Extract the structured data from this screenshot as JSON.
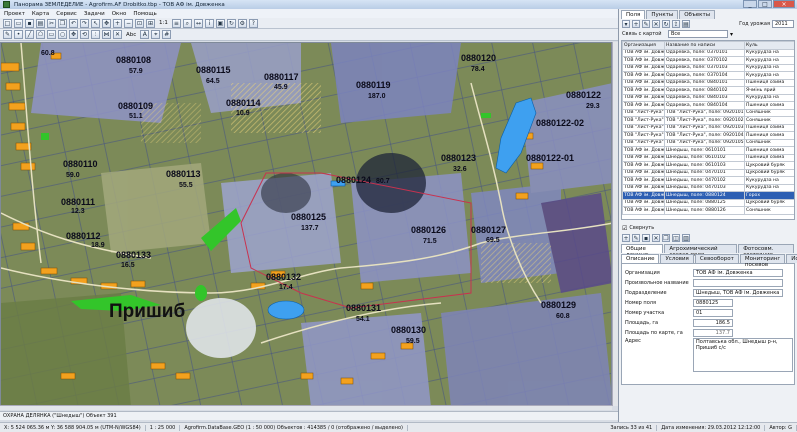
{
  "window": {
    "title": "Панорама ЗЕМЛЕДЕЛИЕ - Agrofirm.AF Drobitko.tbp - ТОВ АФ ім. Довженка",
    "controls": [
      "_",
      "□",
      "×"
    ]
  },
  "menu": [
    "Проект",
    "Карта",
    "Сервис",
    "Задачи",
    "Окно",
    "Помощь"
  ],
  "toolbar": {
    "scale_ratio": "1:1",
    "text_label": "Abc"
  },
  "map": {
    "parcels": [
      {
        "id": "0880108",
        "area": "57.9"
      },
      {
        "id": "0880115",
        "area": "64.5"
      },
      {
        "id": "0880117",
        "area": "45.9"
      },
      {
        "id": "0880119",
        "area": "187.0"
      },
      {
        "id": "0880120",
        "area": "78.4"
      },
      {
        "id": "0880122",
        "area": "29.3"
      },
      {
        "id": "0880109",
        "area": "51.1"
      },
      {
        "id": "0880114",
        "area": "10.9"
      },
      {
        "id": "0880122-02",
        "area": ""
      },
      {
        "id": "0880110",
        "area": "59.0"
      },
      {
        "id": "0880113",
        "area": "55.5"
      },
      {
        "id": "0880123",
        "area": "32.6"
      },
      {
        "id": "0880122-01",
        "area": ""
      },
      {
        "id": "0880111",
        "area": "12.3"
      },
      {
        "id": "0880124",
        "area": "80.7"
      },
      {
        "id": "0880125",
        "area": "137.7"
      },
      {
        "id": "0880126",
        "area": "71.5"
      },
      {
        "id": "0880127",
        "area": "69.5"
      },
      {
        "id": "0880112",
        "area": "18.9"
      },
      {
        "id": "0880133",
        "area": "16.5"
      },
      {
        "id": "0880132",
        "area": "17.4"
      },
      {
        "id": "0880131",
        "area": "54.1"
      },
      {
        "id": "0880129",
        "area": "60.8"
      },
      {
        "id": "0880130",
        "area": "59.5"
      },
      {
        "id": "",
        "area": "60.8"
      }
    ],
    "village_label": "Пришиб"
  },
  "statusbar": {
    "object_line": "ОХРАНА ДЕЛЯНКА (\"Шнедыш\") Объект 391",
    "coords": "X: 5 524 065.36 м   Y: 36 588 904.05 м   (UTM-N/WGS84)",
    "scale": "1 : 25 000",
    "db": "Agrofirm.DataBase.GEO (1 : 50 000)   Объектов : 414385 / 0 (отображено / выделено)",
    "records": "Запись 33 из 41",
    "date": "Дата изменения: 29.03.2012 12:12:00",
    "author": "Автор: G"
  },
  "panel": {
    "tabs": [
      "Поля",
      "Пункты",
      "Объекты"
    ],
    "year_label": "Год урожая",
    "year_value": "2011",
    "link_label": "Связь с картой",
    "link_value": "Все",
    "columns": [
      "Организация",
      "Название по написи",
      "Куль"
    ],
    "rows": [
      [
        "ТОВ АФ ім. Довженка",
        "Одаревка, поле: 0370101",
        "Кукурудза на"
      ],
      [
        "ТОВ АФ ім. Довженка",
        "Одаревка, поле: 0370102",
        "Кукурудза на"
      ],
      [
        "ТОВ АФ ім. Довженка",
        "Одаревка, поле: 0370103",
        "Кукурудза на"
      ],
      [
        "ТОВ АФ ім. Довженка",
        "Одаревка, поле: 0370104",
        "Кукурудза на"
      ],
      [
        "ТОВ АФ ім. Довженка",
        "Одаревка, поле: 0840101",
        "Пшениця озима"
      ],
      [
        "ТОВ АФ ім. Довженка",
        "Одаревка, поле: 0840102",
        "Ячмінь ярий"
      ],
      [
        "ТОВ АФ ім. Довженка",
        "Одаревка, поле: 0840103",
        "Кукурудза на"
      ],
      [
        "ТОВ АФ ім. Довженка",
        "Одаревка, поле: 0840104",
        "Пшениця озима"
      ],
      [
        "ТОВ \"Лист-Рука\"",
        "ТОВ \"Лист-Рука\", поле: 0920101",
        "Соняшник"
      ],
      [
        "ТОВ \"Лист-Рука\"",
        "ТОВ \"Лист-Рука\", поле: 0920102",
        "Соняшник"
      ],
      [
        "ТОВ \"Лист-Рука\"",
        "ТОВ \"Лист-Рука\", поле: 0920103",
        "Пшениця озима"
      ],
      [
        "ТОВ \"Лист-Рука\"",
        "ТОВ \"Лист-Рука\", поле: 0920104",
        "Пшениця озима"
      ],
      [
        "ТОВ \"Лист-Рука\"",
        "ТОВ \"Лист-Рука\", поле: 0920105",
        "Соняшник"
      ],
      [
        "ТОВ АФ ім. Довженка",
        "Шнедыш, поле: 0610101",
        "Пшениця озима"
      ],
      [
        "ТОВ АФ ім. Довженка",
        "Шнедыш, поле: 0610102",
        "Пшениця озима"
      ],
      [
        "ТОВ АФ ім. Довженка",
        "Шнедыш, поле: 0610103",
        "Цукровий буряк"
      ],
      [
        "ТОВ АФ ім. Довженка",
        "Шнедыш, поле: 0470101",
        "Цукровий буряк"
      ],
      [
        "ТОВ АФ ім. Довженка",
        "Шнедыш, поле: 0470102",
        "Кукурудза на"
      ],
      [
        "ТОВ АФ ім. Довженка",
        "Шнедыш, поле: 0470103",
        "Кукурудза на"
      ],
      [
        "ТОВ АФ ім. Довженка",
        "Шнедыш, поле: 0880124",
        "Горох"
      ],
      [
        "ТОВ АФ ім. Довженка",
        "Шнедыш, поле: 0880125",
        "Цукровий буряк"
      ],
      [
        "ТОВ АФ ім. Довженка",
        "Шнедыш, поле: 0880126",
        "Соняшник"
      ]
    ],
    "selected_row": 19,
    "show_checkbox": "Свернуть",
    "subtabs": [
      "Общие данные",
      "Агрохимический состав поля",
      "Фотосовм. состояние"
    ],
    "subtabs2": [
      "Описание",
      "Условия",
      "Севооборот",
      "Мониторинг посевов",
      "История"
    ],
    "form": [
      {
        "label": "Организация",
        "value": "ТОВ АФ ім. Довженка"
      },
      {
        "label": "Произвольное название",
        "value": ""
      },
      {
        "label": "Подразделение",
        "value": "Шнедыш, ТОВ АФ ім. Довженка"
      },
      {
        "label": "Номер поля",
        "value": "0880125"
      },
      {
        "label": "Номер участка",
        "value": "01"
      },
      {
        "label": "Площадь, га",
        "value": "186.5"
      },
      {
        "label": "Площадь по карте, га",
        "value": "137.7"
      },
      {
        "label": "Адрес",
        "value": "Полтавська обл., Шнедыш р-н, Пришиб с/с"
      }
    ]
  },
  "colors": {
    "map_base": "#7c8a58",
    "parcel_blue": "#8f93c7",
    "field_orange": "#f3a11e",
    "selection": "#2d5fb3",
    "water": "#3ea0f0"
  }
}
